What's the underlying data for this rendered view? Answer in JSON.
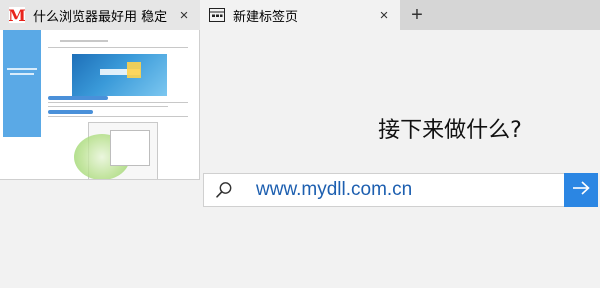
{
  "tabs": [
    {
      "title": "什么浏览器最好用 稳定",
      "icon": "brand-m-icon",
      "close": "×"
    },
    {
      "title": "新建标签页",
      "icon": "new-tab-page-icon",
      "close": "×"
    }
  ],
  "new_tab": {
    "label": "+"
  },
  "main": {
    "heading": "接下来做什么?",
    "search": {
      "value": "www.mydll.com.cn",
      "placeholder": ""
    },
    "go_icon": "arrow-right-icon"
  },
  "colors": {
    "brand_m": "#e8241c",
    "accent": "#2b86e3",
    "url_text": "#1d5fb0"
  }
}
